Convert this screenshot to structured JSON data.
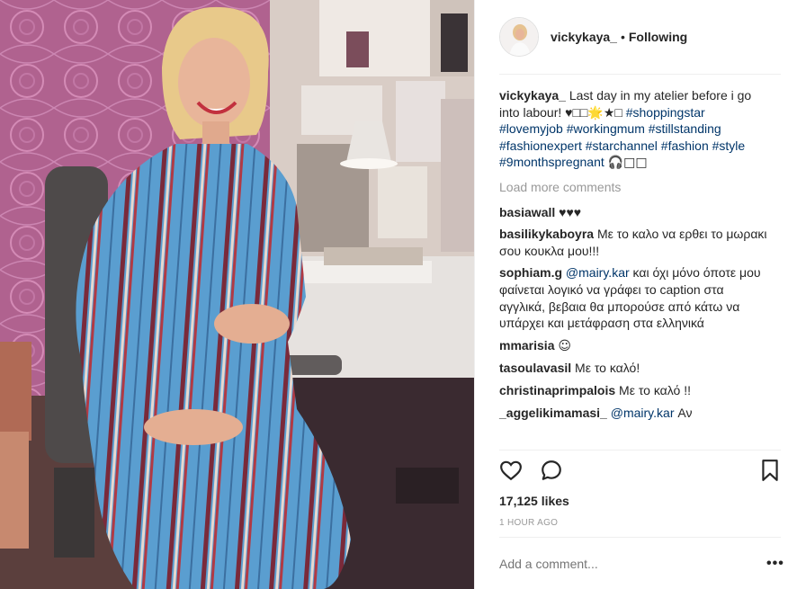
{
  "post": {
    "username": "vickykaya_",
    "follow_status": "Following",
    "bullet": "•",
    "caption_text": "Last day in my atelier before i go into labour! ♥□□🌟★□",
    "hashtags": [
      "#shoppingstar",
      "#lovemyjob",
      "#workingmum",
      "#stillstanding",
      "#fashionexpert",
      "#starchannel",
      "#fashion",
      "#style",
      "#9monthspregnant"
    ],
    "caption_tail": "🎧□□"
  },
  "load_more": "Load more comments",
  "comments": [
    {
      "user": "basiawall",
      "text": "♥♥♥"
    },
    {
      "user": "basilikykaboyra",
      "text": "Με το καλο να ερθει το μωρακι σου κουκλα μου!!!"
    },
    {
      "user": "sophiam.g",
      "mention": "@mairy.kar",
      "text": "και όχι μόνο όποτε μου φαίνεται λογικό να γράφει το caption στα αγγλικά, βεβαια θα μπορούσε από κάτω να υπάρχει και μετάφραση στα ελληνικά"
    },
    {
      "user": "mmarisia",
      "text": "☺"
    },
    {
      "user": "tasoulavasil",
      "text": "Με το καλό!"
    },
    {
      "user": "christinaprimpalois",
      "text": "Με το καλό !!"
    },
    {
      "user": "_aggelikimamasi_",
      "mention": "@mairy.kar",
      "text": "Αν"
    }
  ],
  "likes": "17,125 likes",
  "time": "1 HOUR AGO",
  "add_comment_placeholder": "Add a comment...",
  "more_label": "•••",
  "icons": {
    "like": "heart-icon",
    "comment": "comment-icon",
    "save": "bookmark-icon",
    "more": "ellipsis-icon"
  },
  "colors": {
    "text": "#262626",
    "link": "#003569",
    "muted": "#999999",
    "border": "#efefef"
  }
}
